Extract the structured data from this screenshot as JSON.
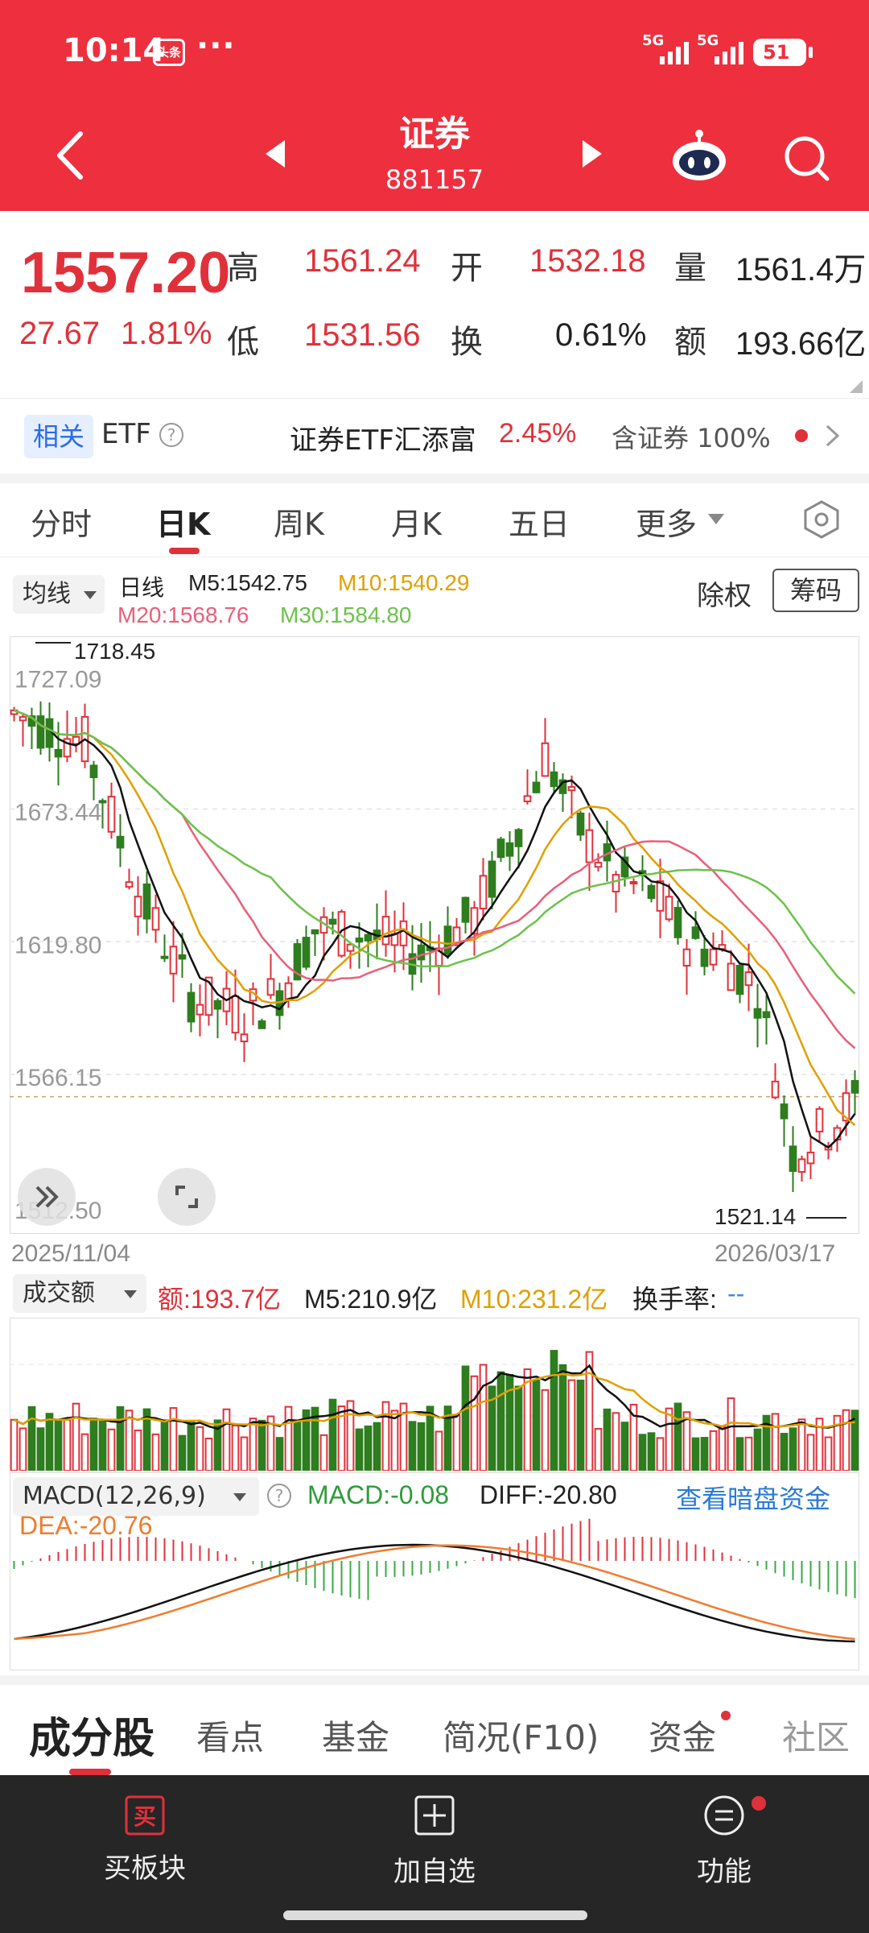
{
  "status_bar": {
    "time": "10:14",
    "news_icon_text": "头条",
    "dots": "···",
    "sig1": "5G",
    "sig2": "5G",
    "battery": "51"
  },
  "header": {
    "title": "证券",
    "code": "881157"
  },
  "quote": {
    "price": "1557.20",
    "change": "27.67",
    "change_pct": "1.81%",
    "high_label": "高",
    "high": "1561.24",
    "open_label": "开",
    "open": "1532.18",
    "vol_label": "量",
    "volume": "1561.4万",
    "low_label": "低",
    "low": "1531.56",
    "turnover_label": "换",
    "turnover": "0.61%",
    "amount_label": "额",
    "amount": "193.66亿"
  },
  "etf": {
    "tag": "相关",
    "label": "ETF",
    "help": "?",
    "name": "证券ETF汇添富",
    "pct": "2.45%",
    "contains": "含证券 100%"
  },
  "tabs": [
    "分时",
    "日K",
    "周K",
    "月K",
    "五日",
    "更多"
  ],
  "ma": {
    "button": "均线",
    "period": "日线",
    "m5": "M5:1542.75",
    "m10": "M10:1540.29",
    "m20": "M20:1568.76",
    "m30": "M30:1584.80",
    "chuquan": "除权",
    "chouma": "筹码"
  },
  "chart": {
    "y_ticks": [
      "1727.09",
      "1673.44",
      "1619.80",
      "1566.15",
      "1512.50"
    ],
    "high_mark": "1718.45",
    "low_mark": "1521.14",
    "date_start": "2025/11/04",
    "date_end": "2026/03/17"
  },
  "volume": {
    "button": "成交额",
    "amount": "额:193.7亿",
    "m5": "M5:210.9亿",
    "m10": "M10:231.2亿",
    "turnover_label": "换手率:",
    "turnover_val": "--"
  },
  "macd": {
    "button": "MACD(12,26,9)",
    "help": "?",
    "macd": "MACD:-0.08",
    "diff": "DIFF:-20.80",
    "dea": "DEA:-20.76",
    "link": "查看暗盘资金"
  },
  "bottom_tabs": [
    "成分股",
    "看点",
    "基金",
    "简况(F10)",
    "资金",
    "社区"
  ],
  "footer": {
    "buy_icon": "买",
    "buy": "买板块",
    "add": "加自选",
    "func": "功能"
  },
  "colors": {
    "header": "#ee2f3e",
    "up": "#e0313b",
    "down": "#2e7d1f",
    "ma5": "#111111",
    "ma10": "#e0a000",
    "ma20": "#e8607a",
    "ma30": "#6cc24a",
    "link": "#2b7bd6"
  }
}
